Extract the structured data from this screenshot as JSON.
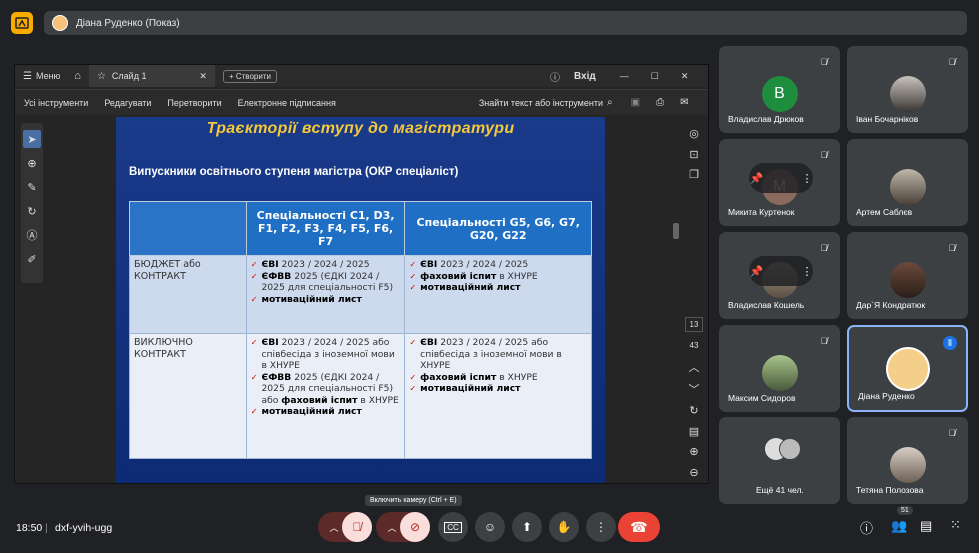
{
  "meet": {
    "presenter_pill": "Діана Руденко (Показ)",
    "time": "18:50",
    "separator": "|",
    "meeting_code": "dxf-yvih-ugg",
    "tooltip": "Включить камеру (Ctrl + E)",
    "people_badge": "51",
    "accent": "#8ab4f8",
    "hangup_color": "#ea4335"
  },
  "viewer": {
    "menu": "Меню",
    "tab": "Слайд 1",
    "create": "Створити",
    "signin": "Вхід",
    "toolbar": [
      "Усі інструменти",
      "Редагувати",
      "Перетворити",
      "Електронне підписання"
    ],
    "find": "Знайти текст або інструменти",
    "page_current": "13",
    "page_total": "43"
  },
  "slide": {
    "title": "Траєкторії вступу до магістратури",
    "subtitle": "Випускники освітнього ступеня магістра (ОКР спеціаліст)",
    "col1_header": "Спеціальності C1, D3, F1, F2, F3, F4, F5, F6, F7",
    "col2_header": "Спеціальності G5, G6, G7, G20, G22",
    "row1_label": "БЮДЖЕТ або КОНТРАКТ",
    "row2_label": "ВИКЛЮЧНО КОНТРАКТ",
    "r1c1": [
      {
        "bold": "ЄВІ",
        "rest": " 2023 / 2024 / 2025"
      },
      {
        "bold": "ЄФВВ",
        "rest": " 2025  (ЄДКІ 2024 / 2025 для спеціальності F5)"
      },
      {
        "bold": "мотиваційний лист",
        "rest": ""
      }
    ],
    "r1c2": [
      {
        "bold": "ЄВІ",
        "rest": " 2023 / 2024 / 2025"
      },
      {
        "bold": "фаховий іспит",
        "rest": " в ХНУРЕ"
      },
      {
        "bold": "мотиваційний лист",
        "rest": ""
      }
    ],
    "r2c1": [
      {
        "bold": "ЄВІ",
        "rest": " 2023 / 2024 / 2025 або співбесіда з іноземної мови в ХНУРЕ"
      },
      {
        "bold": "ЄФВВ",
        "rest": " 2025 (ЄДКІ 2024 / 2025 для спеціальності F5) або "
      },
      {
        "bold": "мотиваційний лист",
        "rest": ""
      }
    ],
    "r2c1_extra_bold": "фаховий іспит",
    "r2c1_extra_rest": " в ХНУРЕ",
    "r2c2": [
      {
        "bold": "ЄВІ",
        "rest": " 2023 / 2024 / 2025 або співбесіда з іноземної мови в ХНУРЕ"
      },
      {
        "bold": "фаховий іспит",
        "rest": " в ХНУРЕ"
      },
      {
        "bold": "мотиваційний лист",
        "rest": ""
      }
    ],
    "check_glyph": "✓"
  },
  "participants": [
    {
      "name": "Владислав Дрюков",
      "initial": "В",
      "color": "#1e8e3e"
    },
    {
      "name": "Іван Бочарніков"
    },
    {
      "name": "Микита Куртенок",
      "initial": "M"
    },
    {
      "name": "Артем Саблєв"
    },
    {
      "name": "Владислав Кошель"
    },
    {
      "name": "Дар`Я Кондратюк"
    },
    {
      "name": "Максим Сидоров"
    },
    {
      "name": "Діана Руденко"
    },
    {
      "name": "Ещё 41 чел."
    },
    {
      "name": "Тетяна Полозова"
    }
  ]
}
